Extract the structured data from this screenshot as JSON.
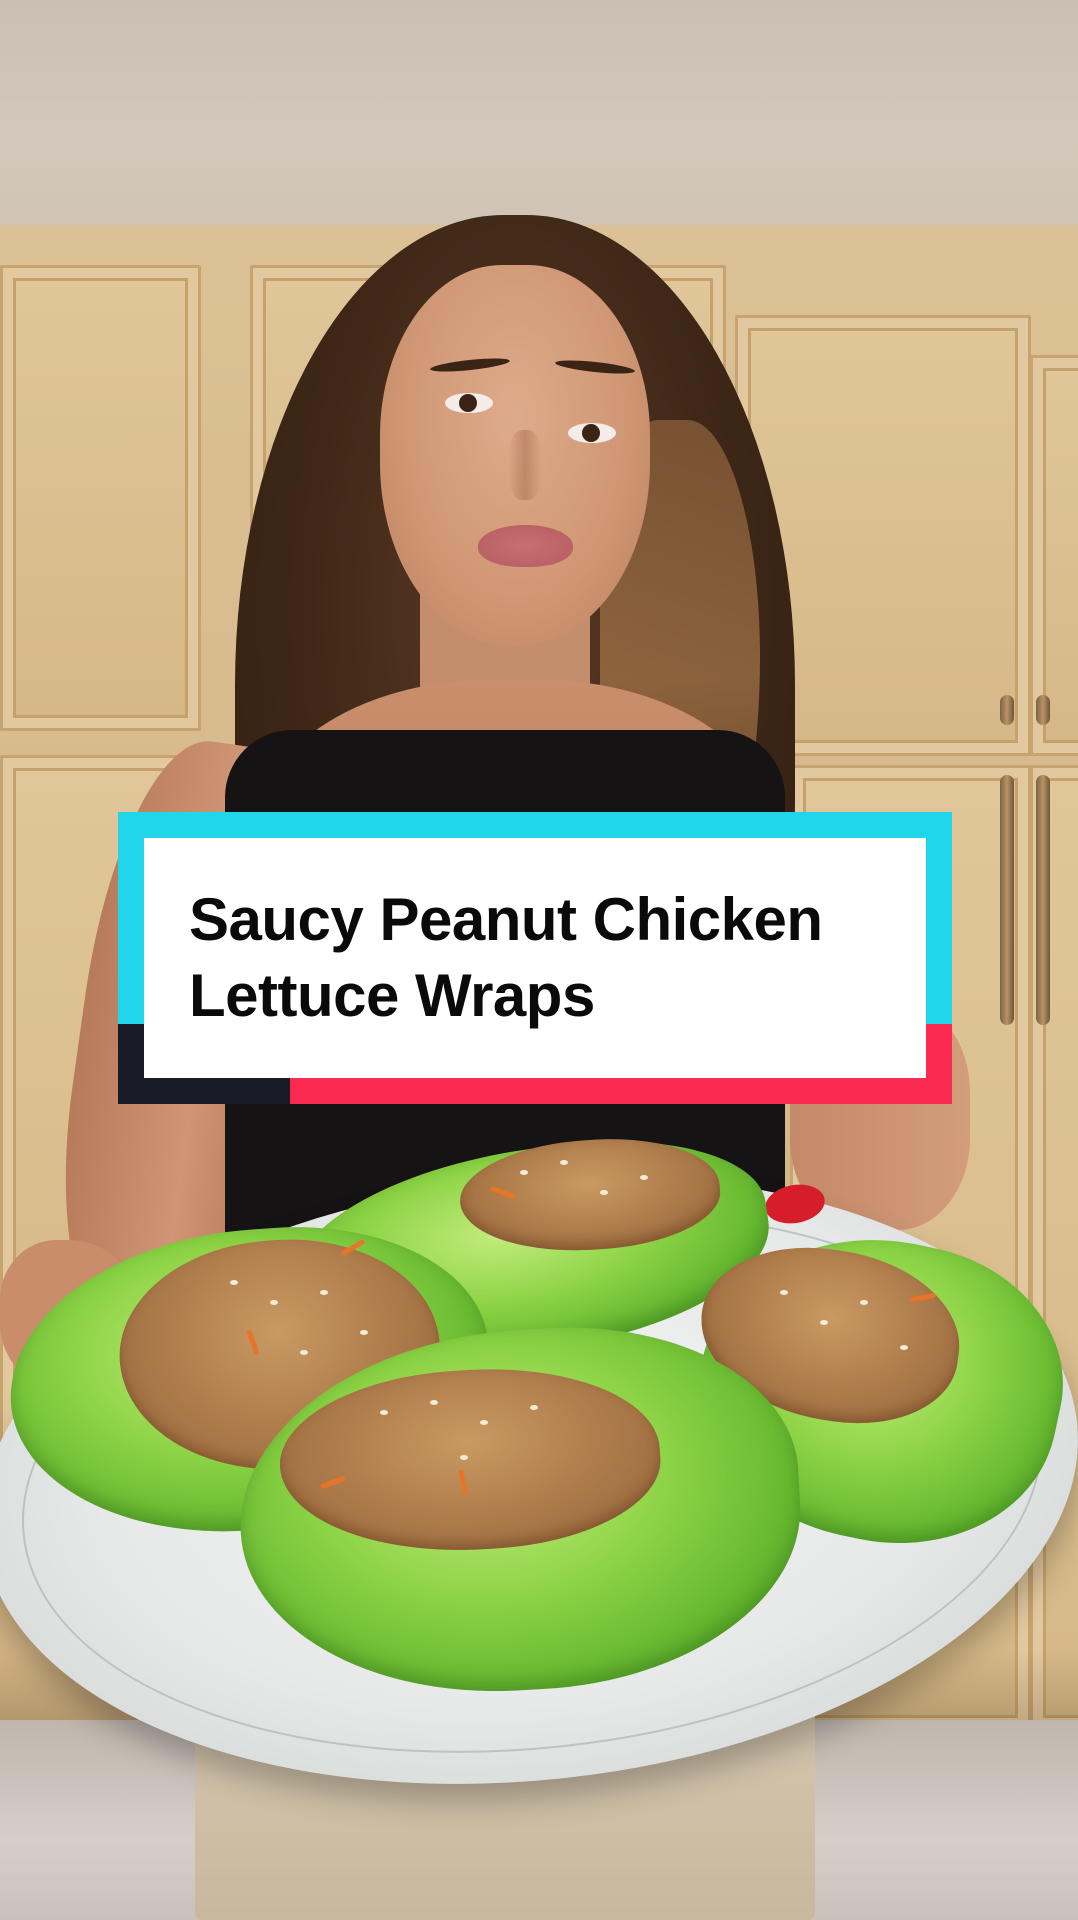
{
  "title_card": {
    "line1": "Saucy Peanut Chicken",
    "line2": "Lettuce Wraps",
    "colors": {
      "cyan": "#21d6ea",
      "red": "#fb2a50",
      "dark": "#181a25",
      "panel": "#ffffff",
      "text": "#0a0a0a"
    }
  },
  "scene": {
    "subject": "person-holding-plate-icon",
    "dish": "lettuce-wraps-icon"
  }
}
